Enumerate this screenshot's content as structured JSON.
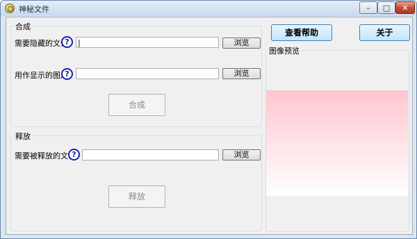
{
  "window": {
    "title": "神秘文件",
    "controls": {
      "minimize": "–",
      "maximize": "□",
      "close": "✕"
    }
  },
  "compose": {
    "group_title": "合成",
    "hide_file": {
      "label": "需要隐藏的文件",
      "value": "|",
      "browse_label": "浏览"
    },
    "display_image": {
      "label": "用作显示的图片",
      "value": "",
      "browse_label": "浏览"
    },
    "action_label": "合成"
  },
  "release": {
    "group_title": "释放",
    "release_file": {
      "label": "需要被释放的文件",
      "value": "",
      "browse_label": "浏览"
    },
    "action_label": "释放"
  },
  "toolbar": {
    "help_label": "查看帮助",
    "about_label": "关于"
  },
  "preview": {
    "group_title": "图像预览"
  },
  "help_icon_glyph": "?",
  "colors": {
    "help_icon": "#1a22a8",
    "preview_gradient_top": "#ffc6d0",
    "button_blue_border": "#3c7fb1"
  }
}
